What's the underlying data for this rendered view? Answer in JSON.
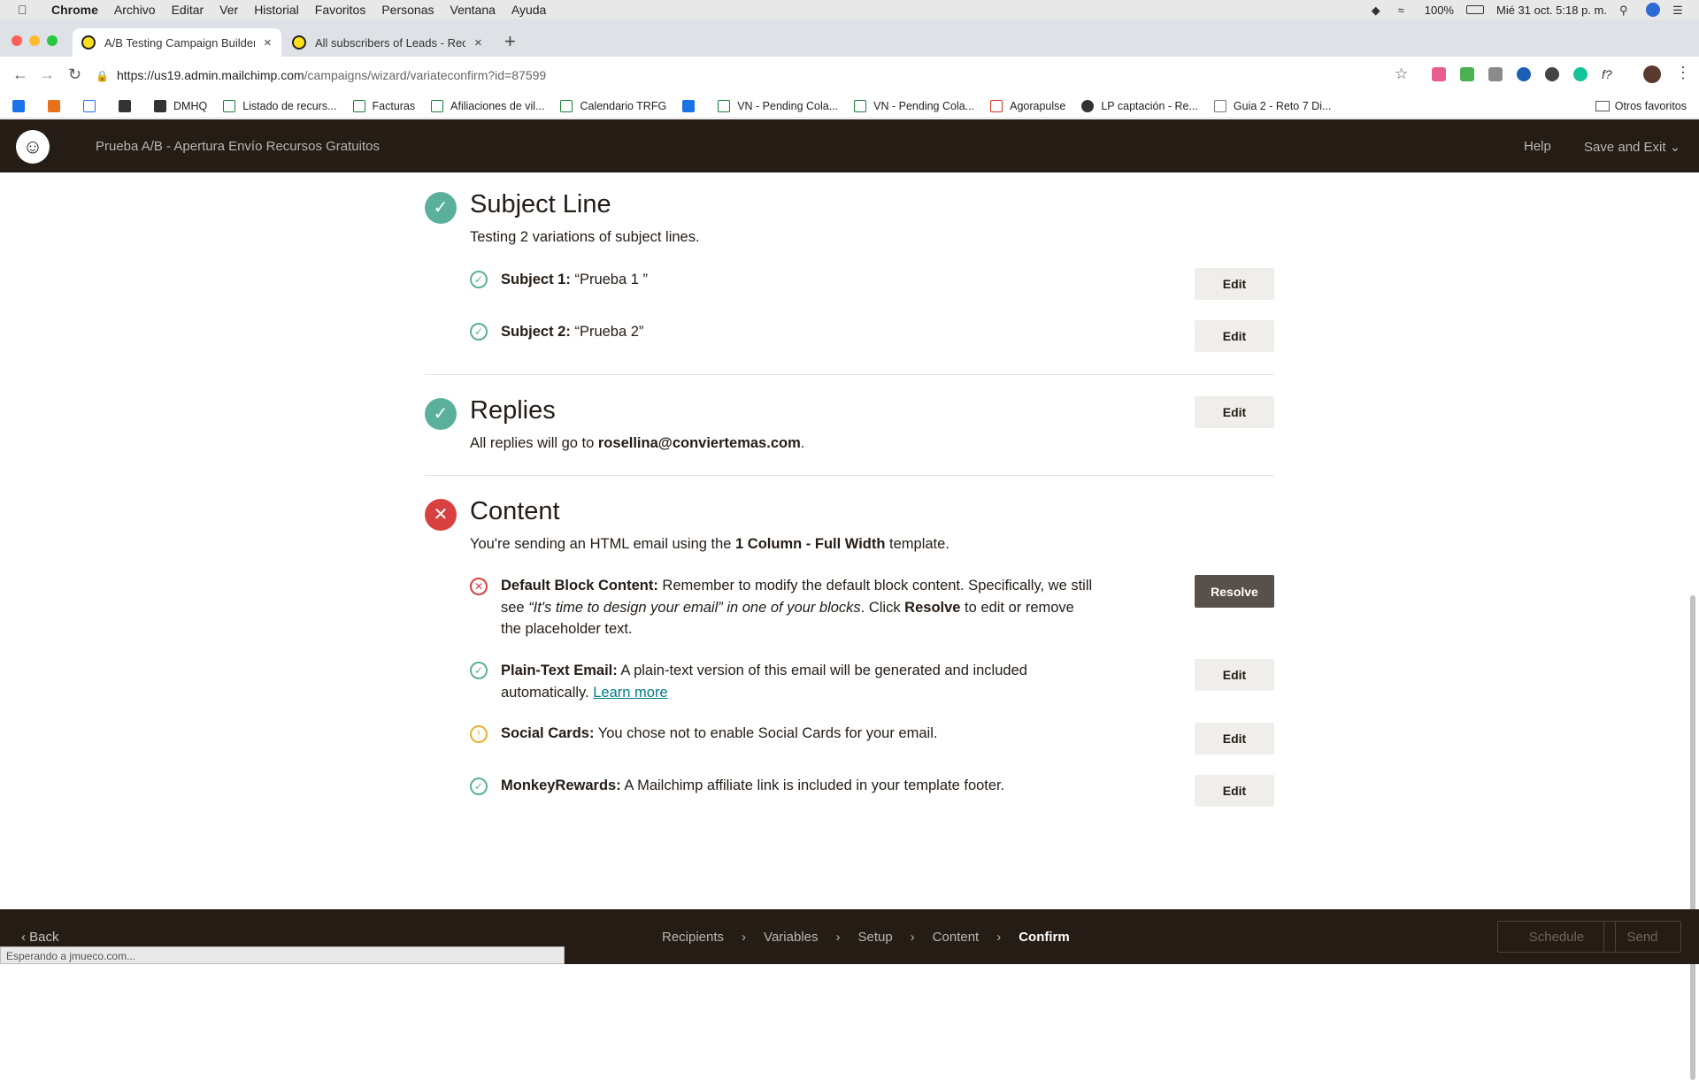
{
  "menubar": {
    "app": "Chrome",
    "items": [
      "Archivo",
      "Editar",
      "Ver",
      "Historial",
      "Favoritos",
      "Personas",
      "Ventana",
      "Ayuda"
    ],
    "battery": "100%",
    "datetime": "Mié 31 oct.  5:18 p. m."
  },
  "tabs": [
    {
      "title": "A/B Testing Campaign Builder",
      "close": "×"
    },
    {
      "title": "All subscribers of Leads - Recu",
      "close": "×"
    }
  ],
  "new_tab": "+",
  "address": {
    "host": "https://us19.admin.mailchimp.com",
    "path": "/campaigns/wizard/variateconfirm?id=87599"
  },
  "bookmarks": [
    "DMHQ",
    "Listado de recurs...",
    "Facturas",
    "Afiliaciones de vil...",
    "Calendario TRFG",
    "VN - Pending Cola...",
    "VN - Pending Cola...",
    "Agorapulse",
    "LP captación - Re...",
    "Guia 2 - Reto 7 Di..."
  ],
  "bookmarks_other": "Otros favoritos",
  "header": {
    "campaign_title": "Prueba A/B - Apertura Envío Recursos Gratuitos",
    "help": "Help",
    "save_exit": "Save and Exit"
  },
  "subject": {
    "title": "Subject Line",
    "desc": "Testing 2 variations of subject lines.",
    "items": [
      {
        "label": "Subject 1:",
        "value": "“Prueba 1 ”",
        "button": "Edit"
      },
      {
        "label": "Subject 2:",
        "value": "“Prueba 2”",
        "button": "Edit"
      }
    ]
  },
  "replies": {
    "title": "Replies",
    "desc_prefix": "All replies will go to ",
    "email": "rosellina@conviertemas.com",
    "desc_suffix": ".",
    "button": "Edit"
  },
  "content": {
    "title": "Content",
    "desc_prefix": "You're sending an HTML email using the ",
    "template": "1 Column - Full Width",
    "desc_suffix": " template.",
    "default_block": {
      "label": "Default Block Content:",
      "text1": " Remember to modify the default block content. Specifically, we still see ",
      "quote": "“It's time to design your email” in one of your blocks",
      "text2": ". Click ",
      "resolve_word": "Resolve",
      "text3": " to edit or remove the placeholder text.",
      "button": "Resolve"
    },
    "plain_text": {
      "label": "Plain-Text Email:",
      "text": " A plain-text version of this email will be generated and included automatically. ",
      "link": "Learn more",
      "button": "Edit"
    },
    "social": {
      "label": "Social Cards:",
      "text": " You chose not to enable Social Cards for your email.",
      "button": "Edit"
    },
    "monkey": {
      "label": "MonkeyRewards:",
      "text": " A Mailchimp affiliate link is included in your template footer.",
      "button": "Edit"
    }
  },
  "footer": {
    "back": "Back",
    "steps": [
      "Recipients",
      "Variables",
      "Setup",
      "Content",
      "Confirm"
    ],
    "schedule": "Schedule",
    "send": "Send"
  },
  "status_text": "Esperando a jmueco.com...",
  "colors": {
    "success": "#5bb09b",
    "error": "#d8413f",
    "warning": "#e7b12c",
    "header_bg": "#241c15",
    "link": "#007c89"
  }
}
